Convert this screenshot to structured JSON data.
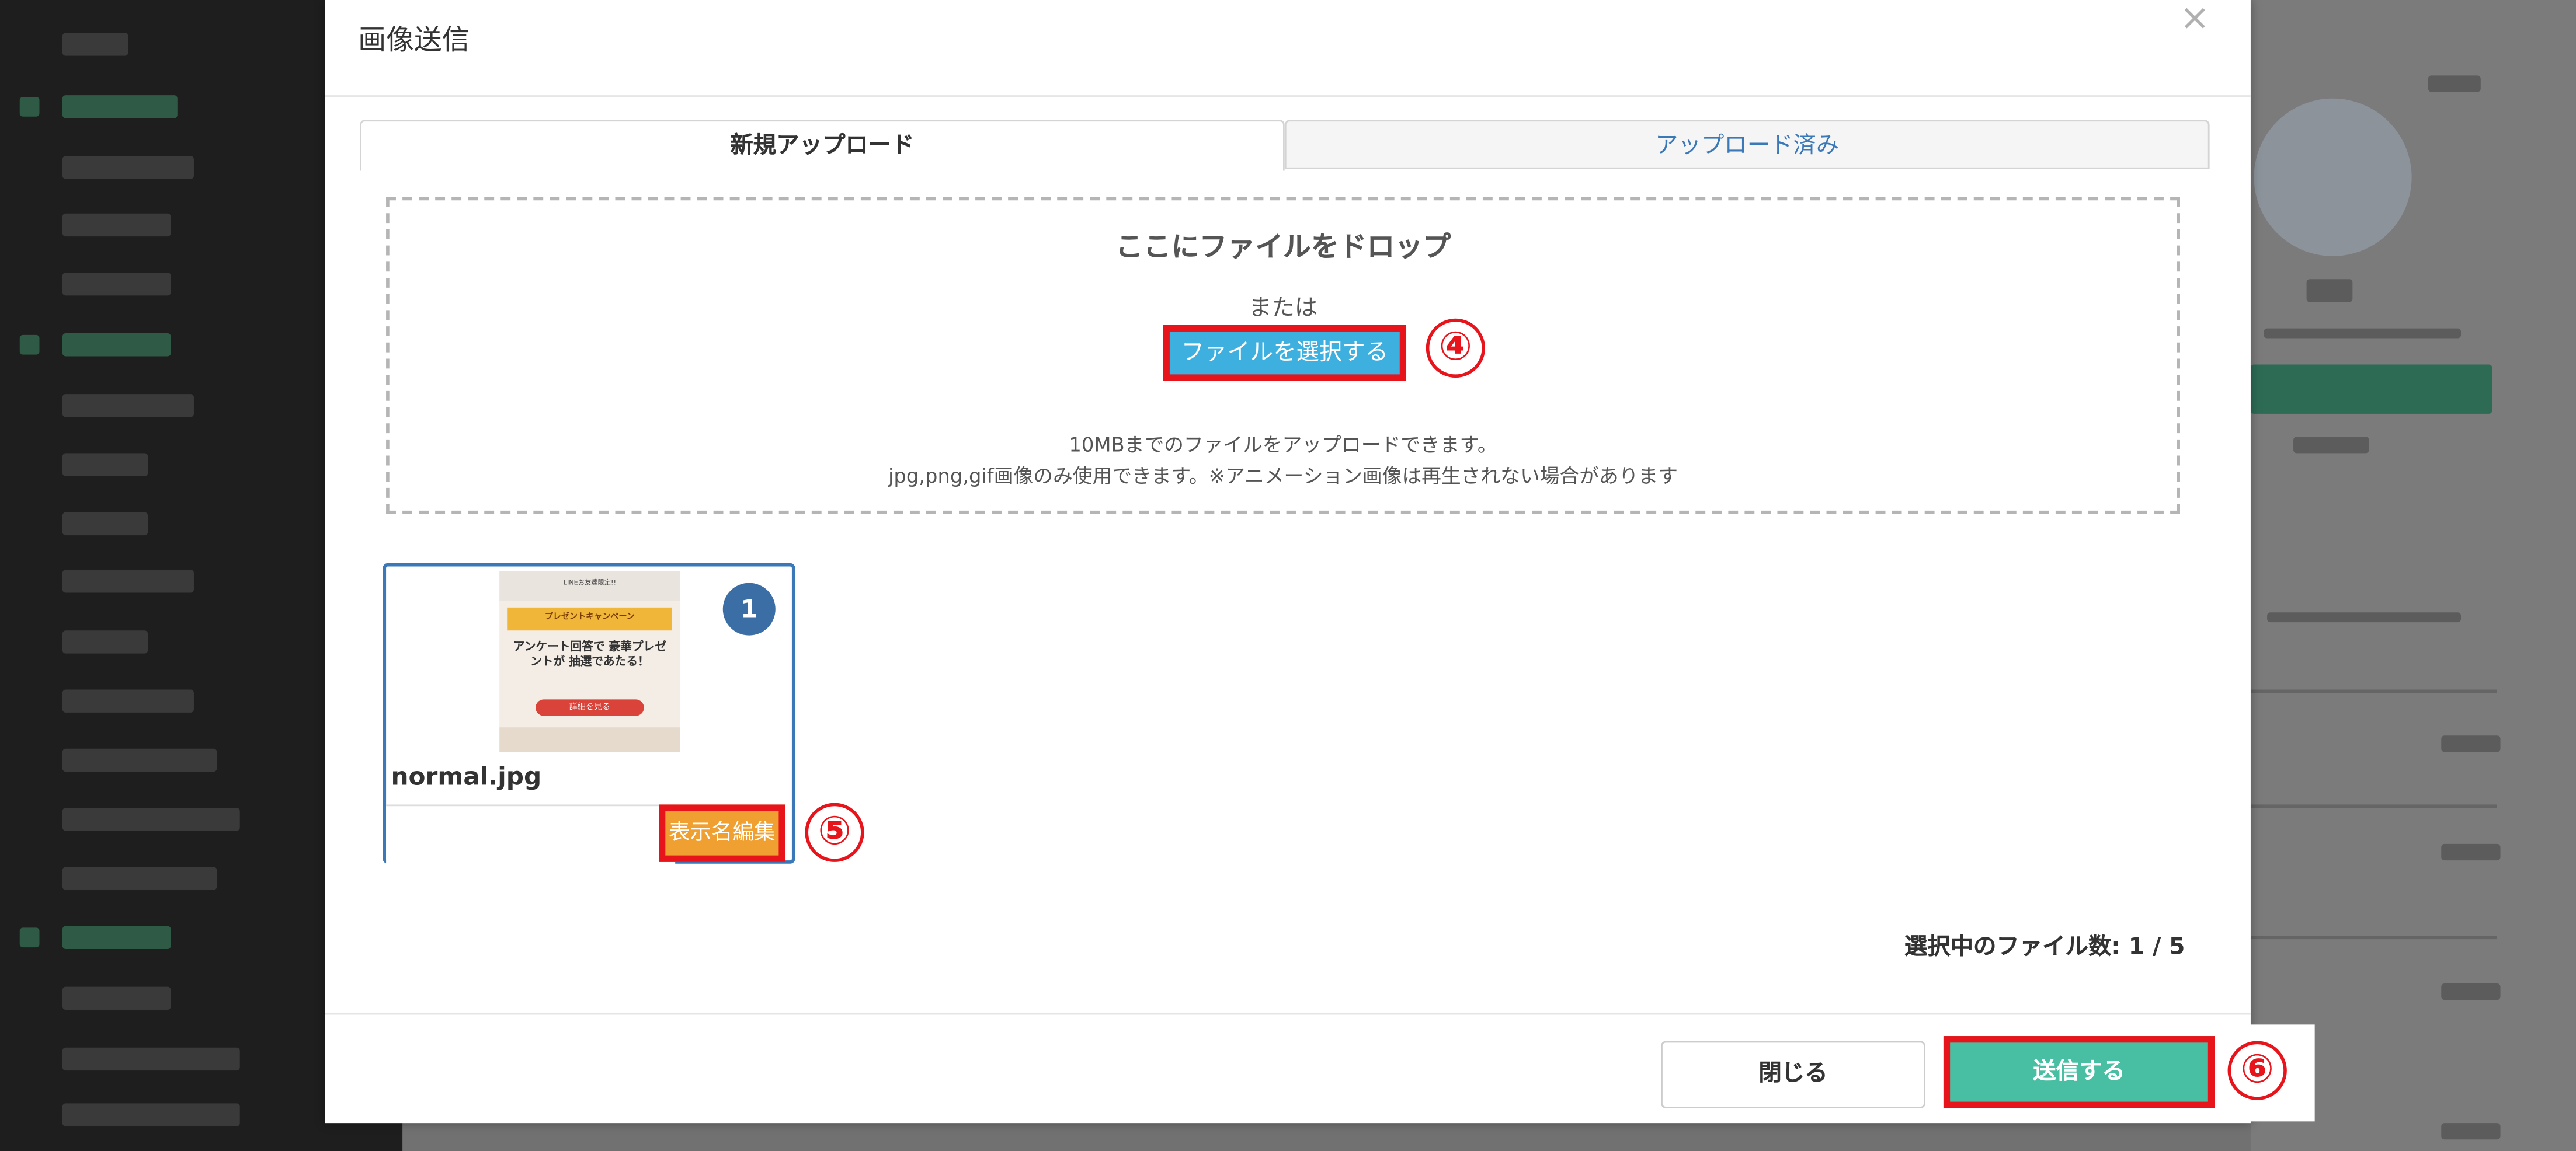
{
  "modal": {
    "title": "画像送信",
    "close_symbol": "×",
    "tabs": [
      {
        "label": "新規アップロード",
        "active": true
      },
      {
        "label": "アップロード済み",
        "active": false
      }
    ],
    "dropzone": {
      "title": "ここにファイルをドロップ",
      "or_text": "または",
      "select_button_label": "ファイルを選択する",
      "note_line1": "10MBまでのファイルをアップロードできます。",
      "note_line2": "jpg,png,gif画像のみ使用できます。※アニメーション画像は再生されない場合があります"
    },
    "file_card": {
      "order_badge": "1",
      "file_name": "normal.jpg",
      "display_name_value": "",
      "edit_name_button_label": "表示名編集",
      "thumbnail": {
        "top_text": "LINEお友達限定!!",
        "banner_text": "プレゼントキャンペーン",
        "heading": "アンケート回答で 豪華プレゼントが 抽選であたる！",
        "button_text": "詳細を見る"
      }
    },
    "selected_count_text": "選択中のファイル数: 1 / 5",
    "footer": {
      "close_button_label": "閉じる",
      "send_button_label": "送信する"
    }
  },
  "annotations": {
    "step4": "④",
    "step5": "⑤",
    "step6": "⑥"
  },
  "colors": {
    "highlight_red": "#e8141b",
    "select_button_blue": "#3eb0e0",
    "edit_button_orange": "#f0a030",
    "send_button_green": "#48bfa3",
    "tab_link_blue": "#3a78b8",
    "badge_blue": "#3a6ea5"
  }
}
